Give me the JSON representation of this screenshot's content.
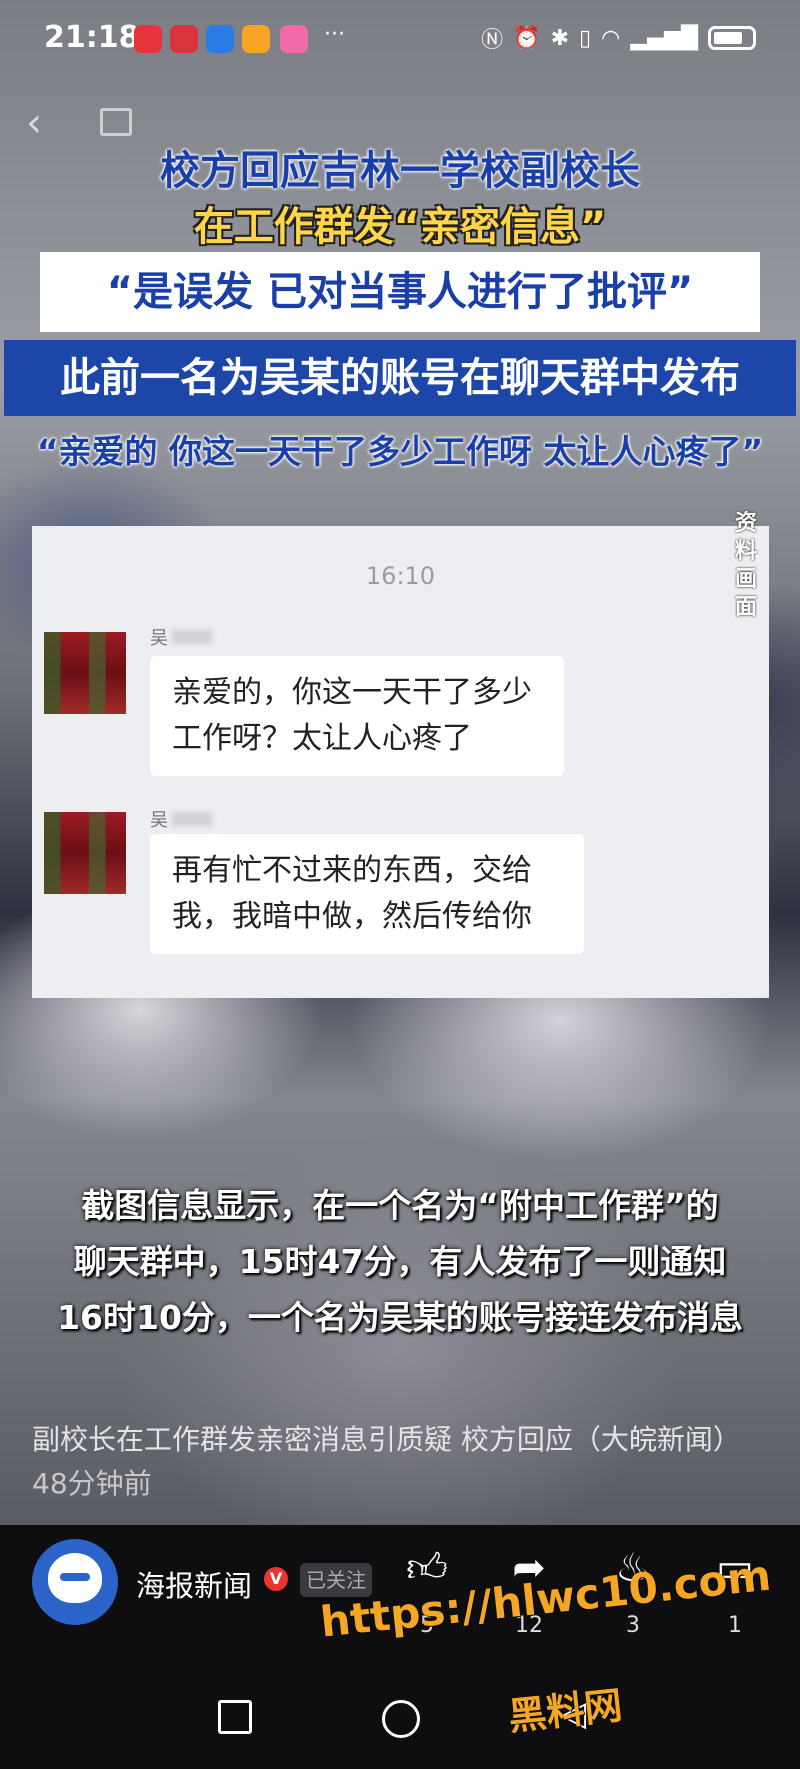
{
  "status_bar": {
    "time": "21:18",
    "more": "···"
  },
  "headline": {
    "line1": "校方回应吉林一学校副校长",
    "line2": "在工作群发“亲密信息”",
    "line3": "“是误发 已对当事人进行了批评”",
    "line4": "此前一名为吴某的账号在聊天群中发布",
    "line5": "“亲爱的 你这一天干了多少工作呀 太让人心疼了”"
  },
  "chat": {
    "time": "16:10",
    "side_label": "资料画面",
    "messages": [
      {
        "sender": "吴",
        "text": "亲爱的，你这一天干了多少工作呀？太让人心疼了"
      },
      {
        "sender": "吴",
        "text": "再有忙不过来的东西，交给我，我暗中做，然后传给你"
      }
    ]
  },
  "caption": {
    "line1": "截图信息显示，在一个名为“附中工作群”的",
    "line2": "聊天群中，15时47分，有人发布了一则通知",
    "line3": "16时10分，一个名为吴某的账号接连发布消息"
  },
  "video": {
    "title": "副校长在工作群发亲密消息引质疑 校方回应（大皖新闻）",
    "age": "48分钟前"
  },
  "account": {
    "name": "海报新闻",
    "verified": "V",
    "follow_label": "已关注"
  },
  "actions": {
    "like": "5",
    "share": "12",
    "fire": "3",
    "comment": "1"
  },
  "watermark": {
    "url": "https://hlwc10.com",
    "name": "黑料网"
  },
  "colors": {
    "headline_blue": "#1a3fa8",
    "headline_yellow": "#ffd54a",
    "watermark": "#f5a623"
  }
}
